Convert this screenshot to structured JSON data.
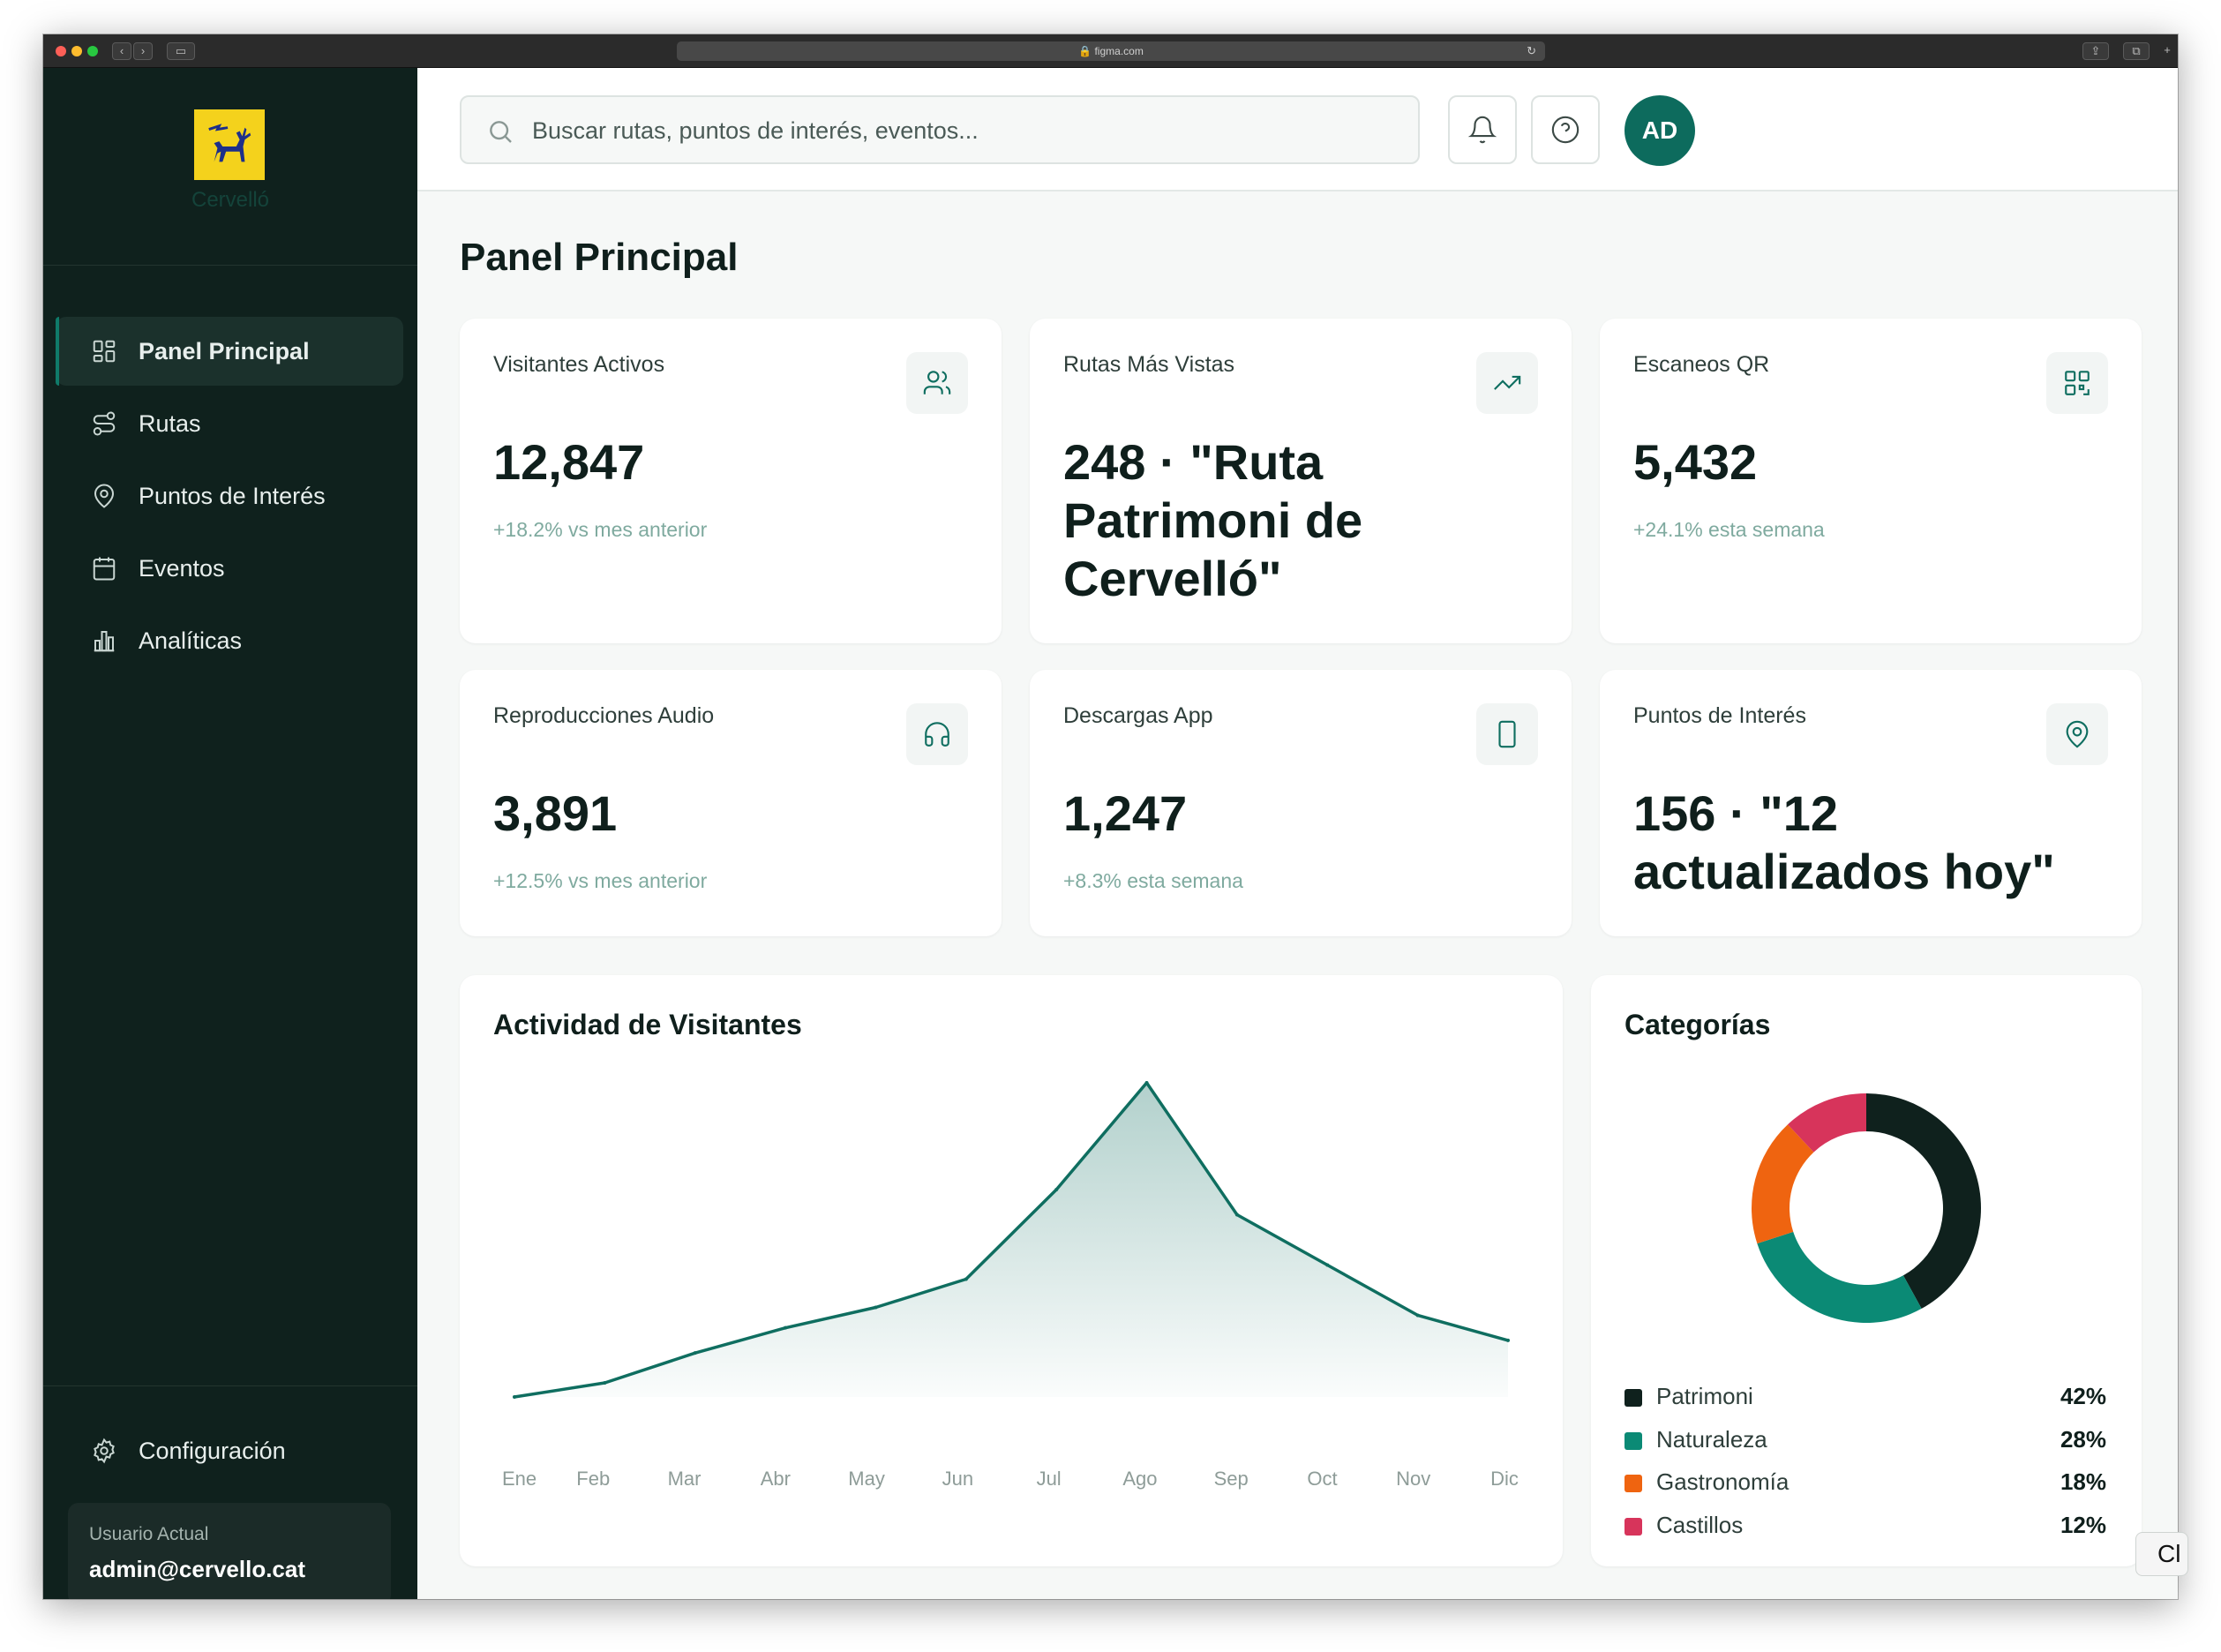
{
  "browser": {
    "url": "figma.com"
  },
  "sidebar": {
    "brand": "Cervelló",
    "items": [
      {
        "label": "Panel Principal",
        "icon": "grid-icon",
        "active": true
      },
      {
        "label": "Rutas",
        "icon": "route-icon"
      },
      {
        "label": "Puntos de Interés",
        "icon": "map-pin-icon"
      },
      {
        "label": "Eventos",
        "icon": "calendar-icon"
      },
      {
        "label": "Analíticas",
        "icon": "bar-chart-icon"
      }
    ],
    "settings_label": "Configuración",
    "user_caption": "Usuario Actual",
    "user_email": "admin@cervello.cat"
  },
  "header": {
    "search_placeholder": "Buscar rutas, puntos de interés, eventos...",
    "avatar_initials": "AD"
  },
  "page_title": "Panel Principal",
  "stats": [
    {
      "label": "Visitantes Activos",
      "value": "12,847",
      "sub": "+18.2% vs mes anterior",
      "icon": "users-icon"
    },
    {
      "label": "Rutas Más Vistas",
      "value": "248 · \"Ruta Patrimoni de Cervelló\"",
      "sub": "",
      "icon": "trending-up-icon"
    },
    {
      "label": "Escaneos QR",
      "value": "5,432",
      "sub": "+24.1% esta semana",
      "icon": "qr-code-icon"
    },
    {
      "label": "Reproducciones Audio",
      "value": "3,891",
      "sub": "+12.5% vs mes anterior",
      "icon": "headphones-icon"
    },
    {
      "label": "Descargas App",
      "value": "1,247",
      "sub": "+8.3% esta semana",
      "icon": "smartphone-icon"
    },
    {
      "label": "Puntos de Interés",
      "value": "156 · \"12 actualizados hoy\"",
      "sub": "",
      "icon": "map-pin-icon"
    }
  ],
  "activity": {
    "title": "Actividad de Visitantes"
  },
  "categories": {
    "title": "Categorías"
  },
  "corner_button": "Cl",
  "colors": {
    "sidebar_bg": "#0f211d",
    "accent": "#0d6b5d",
    "line": "#0f6e60",
    "patrimoni": "#0f211d",
    "naturaleza": "#0b8a75",
    "gastronomia": "#ef6410",
    "castillos": "#d7345b"
  },
  "chart_data": [
    {
      "type": "area",
      "title": "Actividad de Visitantes",
      "categories": [
        "Ene",
        "Feb",
        "Mar",
        "Abr",
        "May",
        "Jun",
        "Jul",
        "Ago",
        "Sep",
        "Oct",
        "Nov",
        "Dic"
      ],
      "values": [
        0,
        4.5,
        14,
        22,
        28.5,
        37.5,
        66,
        100,
        58,
        42,
        26,
        18
      ],
      "ylim": [
        0,
        100
      ],
      "grid": false
    },
    {
      "type": "pie",
      "title": "Categorías",
      "donut": true,
      "labels": [
        "Patrimoni",
        "Naturaleza",
        "Gastronomía",
        "Castillos"
      ],
      "values": [
        42,
        28,
        18,
        12
      ],
      "display": [
        "42%",
        "28%",
        "18%",
        "12%"
      ],
      "colors": [
        "#0f211d",
        "#0b8a75",
        "#ef6410",
        "#d7345b"
      ]
    }
  ]
}
